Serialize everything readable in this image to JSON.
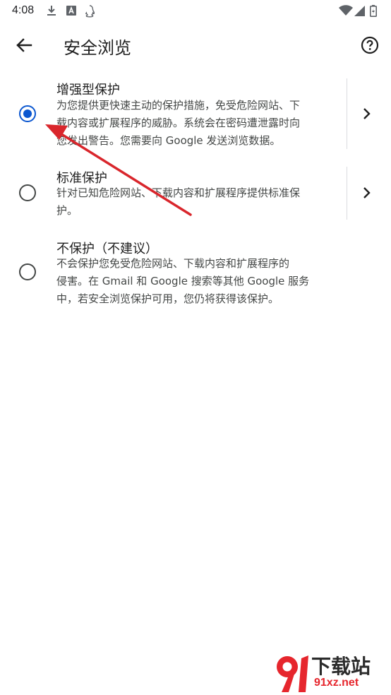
{
  "status_bar": {
    "time": "4:08",
    "icons_left": [
      "download-icon",
      "font-a-icon",
      "qq-penguin-icon"
    ],
    "icons_right": [
      "wifi-icon",
      "signal-icon",
      "battery-icon"
    ]
  },
  "app_bar": {
    "title": "安全浏览",
    "back_icon": "arrow-back-icon",
    "help_icon": "help-circle-icon"
  },
  "options": [
    {
      "title": "增强型保护",
      "desc_lines": [
        "为您提供更快速主动的保护措施，免受危险网站、下",
        "载内容或扩展程序的威胁。系统会在密码遭泄露时向",
        "您发出警告。您需要向 Google 发送浏览数据。"
      ],
      "selected": true,
      "has_details": true
    },
    {
      "title": "标准保护",
      "desc_lines": [
        "针对已知危险网站、下载内容和扩展程序提供标准保",
        "护。"
      ],
      "selected": false,
      "has_details": true
    },
    {
      "title": "不保护（不建议）",
      "desc_lines": [
        "不会保护您免受危险网站、下载内容和扩展程序的",
        "侵害。在 Gmail 和 Google 搜索等其他 Google 服务",
        "中，若安全浏览保护可用，您仍将获得该保护。"
      ],
      "selected": false,
      "has_details": false
    }
  ],
  "colors": {
    "accent": "#0b57d0",
    "annotation_arrow": "#d9262c"
  },
  "watermark": {
    "logo_text": "下载站",
    "url": "91xz.net"
  }
}
